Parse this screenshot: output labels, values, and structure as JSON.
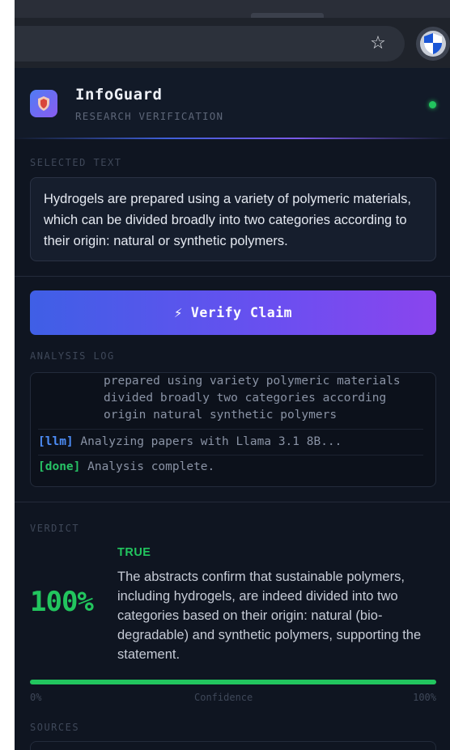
{
  "browser": {
    "star_icon": "star-icon",
    "extension_icon": "shield-icon"
  },
  "header": {
    "name": "InfoGuard",
    "subtitle": "RESEARCH VERIFICATION",
    "status_color": "#22c55e"
  },
  "selected": {
    "label": "SELECTED TEXT",
    "text": "Hydrogels are prepared using a variety of polymeric materials, which can be divided broadly into two categories according to their origin: natural or synthetic polymers."
  },
  "verify": {
    "bolt": "⚡",
    "label": "Verify Claim"
  },
  "log": {
    "label": "ANALYSIS LOG",
    "continuation": "prepared using variety polymeric materials divided broadly two categories according origin natural synthetic polymers",
    "entries": [
      {
        "tag": "[llm]",
        "text": " Analyzing papers with Llama 3.1 8B..."
      },
      {
        "tag": "[done]",
        "text": " Analysis complete."
      }
    ]
  },
  "verdict": {
    "label": "VERDICT",
    "result": "TRUE",
    "percent": "100%",
    "confidence": 1.0,
    "explanation": "The abstracts confirm that sustainable polymers, including hydrogels, are indeed divided into two categories based on their origin: natural (bio-degradable) and synthetic polymers, supporting the statement.",
    "bar_min": "0%",
    "bar_label": "Confidence",
    "bar_max": "100%",
    "accent": "#22c55e"
  },
  "sources": {
    "label": "SOURCES"
  }
}
